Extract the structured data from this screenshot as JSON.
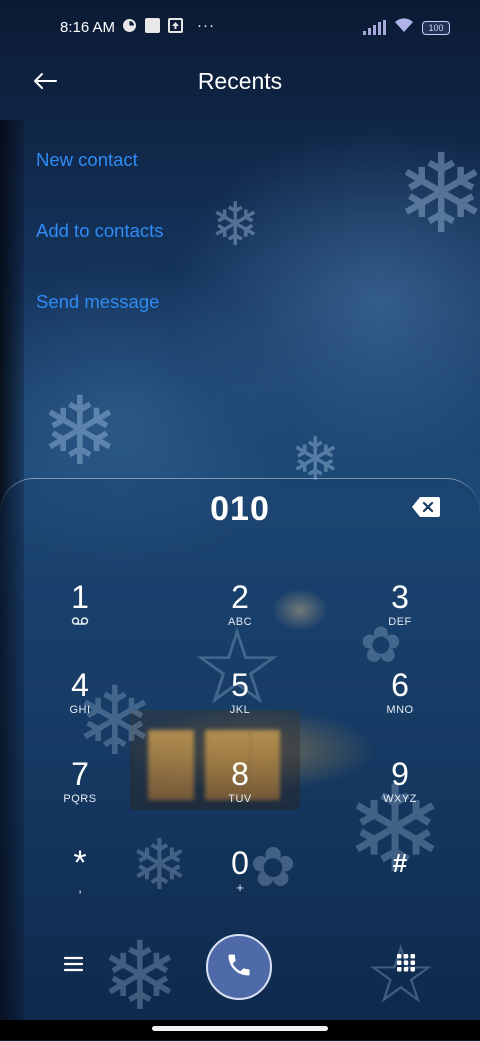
{
  "status_bar": {
    "time": "8:16 AM",
    "more_dots": "···",
    "battery_level": "100",
    "icons": [
      "data-saver-icon",
      "notification-square-icon",
      "upload-icon",
      "signal-icon",
      "wifi-icon",
      "battery-icon"
    ]
  },
  "header": {
    "title": "Recents",
    "back_icon": "arrow-left-icon"
  },
  "actions": [
    {
      "label": "New contact"
    },
    {
      "label": "Add to contacts"
    },
    {
      "label": "Send message"
    }
  ],
  "dialer": {
    "number": "010",
    "keys": [
      {
        "digit": "1",
        "sub": "voicemail"
      },
      {
        "digit": "2",
        "sub": "ABC"
      },
      {
        "digit": "3",
        "sub": "DEF"
      },
      {
        "digit": "4",
        "sub": "GHI"
      },
      {
        "digit": "5",
        "sub": "JKL"
      },
      {
        "digit": "6",
        "sub": "MNO"
      },
      {
        "digit": "7",
        "sub": "PQRS"
      },
      {
        "digit": "8",
        "sub": "TUV"
      },
      {
        "digit": "9",
        "sub": "WXYZ"
      },
      {
        "digit": "*",
        "sub": ","
      },
      {
        "digit": "0",
        "sub": "+"
      },
      {
        "digit": "#",
        "sub": ""
      }
    ]
  },
  "bottom_bar": {
    "menu_icon": "hamburger-menu-icon",
    "call_icon": "phone-icon",
    "dialpad_icon": "dialpad-icon"
  },
  "colors": {
    "link": "#2f8cf5",
    "call_button": "#4e6aa8"
  }
}
